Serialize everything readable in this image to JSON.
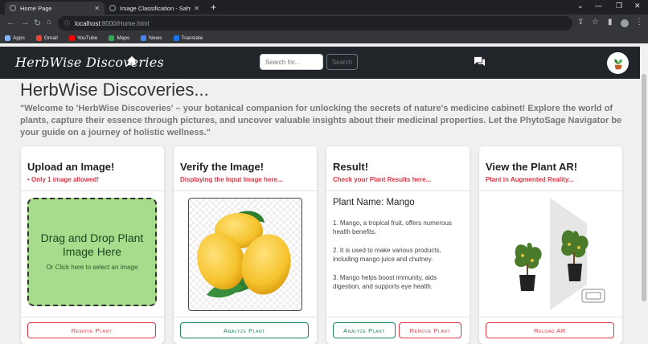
{
  "browser": {
    "tabs": [
      {
        "title": "Home Page"
      },
      {
        "title": "Image Classification - Sahyadri c"
      }
    ],
    "url_host": "localhost",
    "url_path": ":8000/Home.html",
    "bookmarks": [
      {
        "label": "Apps",
        "color": "#8ab4f8"
      },
      {
        "label": "Gmail",
        "color": "#ea4335"
      },
      {
        "label": "YouTube",
        "color": "#ff0000"
      },
      {
        "label": "Maps",
        "color": "#34a853"
      },
      {
        "label": "News",
        "color": "#4285f4"
      },
      {
        "label": "Translate",
        "color": "#1a73e8"
      }
    ]
  },
  "navbar": {
    "brand": "HerbWise Discoveries",
    "search_placeholder": "Search for...",
    "search_button": "Search"
  },
  "page": {
    "title": "HerbWise Discoveries...",
    "intro": "\"Welcome to 'HerbWise Discoveries' – your botanical companion for unlocking the secrets of nature's medicine cabinet! Explore the world of plants, capture their essence through pictures, and uncover valuable insights about their medicinal properties. Let the PhytoSage Navigator be your guide on a journey of holistic wellness.\""
  },
  "cards": {
    "upload": {
      "title": "Upload an Image!",
      "subtitle": "• Only 1 image allowed!",
      "drop_main": "Drag and Drop Plant Image Here",
      "drop_sub": "Or Click here to select an image",
      "button": "Remove Plant"
    },
    "verify": {
      "title": "Verify the Image!",
      "subtitle": "Displaying the Input Image here...",
      "button": "Analyze Plant"
    },
    "result": {
      "title": "Result!",
      "subtitle": "Check your Plant Results here...",
      "plant_name": "Plant Name: Mango",
      "lines": [
        "1. Mango, a tropical fruit, offers numerous health benefits.",
        "2. It is used to make various products, including mango juice and chutney.",
        "3. Mango helps boost immunity, aids digestion, and supports eye health."
      ],
      "button_analyze": "Analyze Plant",
      "button_remove": "Remove Plant"
    },
    "ar": {
      "title": "View the Plant AR!",
      "subtitle": "Plant in Augmented Reality...",
      "button": "Reload AR"
    }
  },
  "colors": {
    "navbar": "#212529",
    "accent_red": "#dc3545",
    "accent_green": "#198754",
    "dropzone": "#a7dc8c"
  }
}
